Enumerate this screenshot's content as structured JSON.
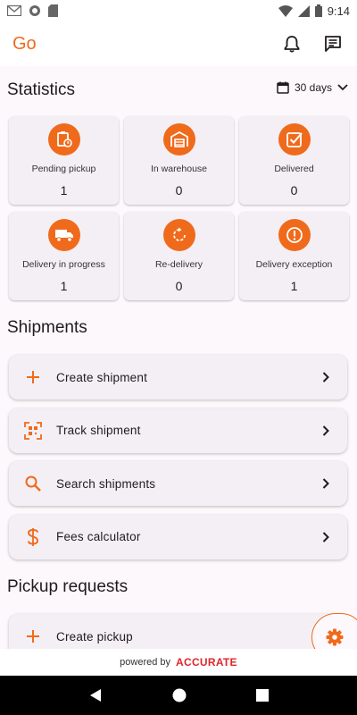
{
  "status_bar": {
    "time": "9:14"
  },
  "app_bar": {
    "title": "Go"
  },
  "statistics": {
    "title": "Statistics",
    "period": "30 days",
    "cards": [
      {
        "label": "Pending pickup",
        "value": "1",
        "icon": "clipboard-clock-icon"
      },
      {
        "label": "In warehouse",
        "value": "0",
        "icon": "warehouse-icon"
      },
      {
        "label": "Delivered",
        "value": "0",
        "icon": "check-box-icon"
      },
      {
        "label": "Delivery in progress",
        "value": "1",
        "icon": "truck-icon"
      },
      {
        "label": "Re-delivery",
        "value": "0",
        "icon": "redo-icon"
      },
      {
        "label": "Delivery exception",
        "value": "1",
        "icon": "alert-icon"
      }
    ]
  },
  "shipments": {
    "title": "Shipments",
    "items": [
      {
        "label": "Create shipment",
        "icon": "plus-icon"
      },
      {
        "label": "Track shipment",
        "icon": "qr-scan-icon"
      },
      {
        "label": "Search shipments",
        "icon": "search-icon"
      },
      {
        "label": "Fees calculator",
        "icon": "dollar-icon"
      }
    ]
  },
  "pickup_requests": {
    "title": "Pickup requests",
    "items": [
      {
        "label": "Create pickup",
        "icon": "plus-icon"
      }
    ]
  },
  "footer": {
    "powered_by": "powered by",
    "brand": "ACCURATE"
  },
  "colors": {
    "accent": "#f06a1b",
    "brand": "#e0262b",
    "background": "#fdf8fc",
    "card": "#f4eff4"
  }
}
